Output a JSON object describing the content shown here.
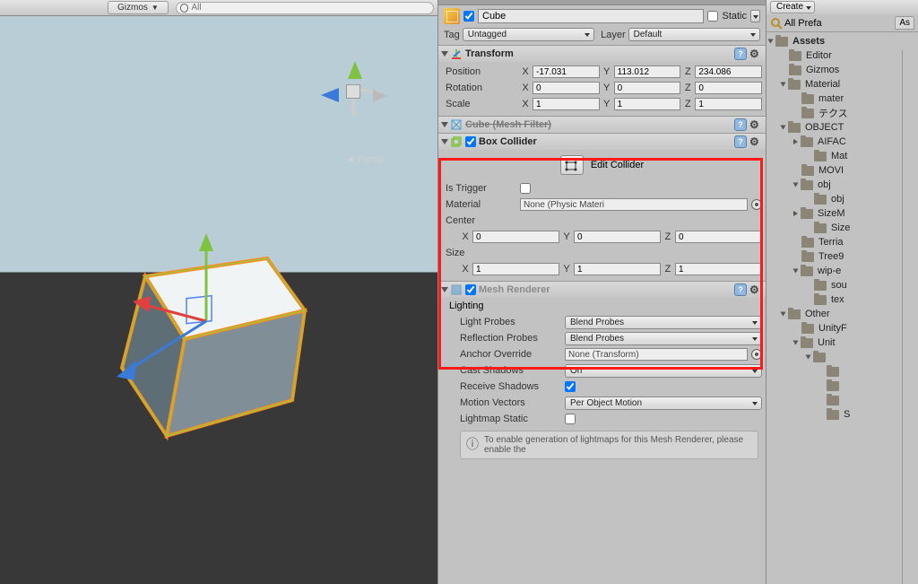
{
  "scene": {
    "gizmos_label": "Gizmos",
    "search_placeholder": "All",
    "persp_label": "Persp",
    "axis_y": "y"
  },
  "inspector": {
    "active": true,
    "name": "Cube",
    "static_label": "Static",
    "tag_label": "Tag",
    "tag_value": "Untagged",
    "layer_label": "Layer",
    "layer_value": "Default",
    "transform": {
      "title": "Transform",
      "position_label": "Position",
      "rotation_label": "Rotation",
      "scale_label": "Scale",
      "pos_x": "-17.031",
      "pos_y": "113.012",
      "pos_z": "234.086",
      "rot_x": "0",
      "rot_y": "0",
      "rot_z": "0",
      "scl_x": "1",
      "scl_y": "1",
      "scl_z": "1"
    },
    "mesh_filter": {
      "title": "Cube (Mesh Filter)"
    },
    "box_collider": {
      "title": "Box Collider",
      "edit_label": "Edit Collider",
      "is_trigger_label": "Is Trigger",
      "material_label": "Material",
      "material_value": "None (Physic Materi",
      "center_label": "Center",
      "center_x": "0",
      "center_y": "0",
      "center_z": "0",
      "size_label": "Size",
      "size_x": "1",
      "size_y": "1",
      "size_z": "1"
    },
    "mesh_renderer": {
      "title": "Mesh Renderer"
    },
    "lighting": {
      "title": "Lighting",
      "light_probes_label": "Light Probes",
      "light_probes_value": "Blend Probes",
      "reflection_probes_label": "Reflection Probes",
      "reflection_probes_value": "Blend Probes",
      "anchor_override_label": "Anchor Override",
      "anchor_override_value": "None (Transform)",
      "cast_shadows_label": "Cast Shadows",
      "cast_shadows_value": "On",
      "receive_shadows_label": "Receive Shadows",
      "motion_vectors_label": "Motion Vectors",
      "motion_vectors_value": "Per Object Motion",
      "lightmap_static_label": "Lightmap Static",
      "info_text": "To enable generation of lightmaps for this Mesh Renderer, please enable the"
    }
  },
  "project": {
    "create_label": "Create",
    "search_text": "All Prefa",
    "ass_tab": "As",
    "tree": [
      {
        "name": "Assets",
        "depth": 0,
        "open": true
      },
      {
        "name": "Editor",
        "depth": 1,
        "open": false,
        "leaf": true
      },
      {
        "name": "Gizmos",
        "depth": 1,
        "open": false,
        "leaf": true
      },
      {
        "name": "Material",
        "depth": 1,
        "open": true
      },
      {
        "name": "mater",
        "depth": 2,
        "open": false,
        "leaf": true
      },
      {
        "name": "テクス",
        "depth": 2,
        "open": false,
        "leaf": true
      },
      {
        "name": "OBJECT",
        "depth": 1,
        "open": true
      },
      {
        "name": "AIFAC",
        "depth": 2,
        "open": false
      },
      {
        "name": "Mat",
        "depth": 3,
        "open": false,
        "leaf": true
      },
      {
        "name": "MOVI",
        "depth": 2,
        "open": false,
        "leaf": true
      },
      {
        "name": "obj",
        "depth": 2,
        "open": true
      },
      {
        "name": "obj",
        "depth": 3,
        "open": false,
        "leaf": true
      },
      {
        "name": "SizeM",
        "depth": 2,
        "open": false
      },
      {
        "name": "Size",
        "depth": 3,
        "open": false,
        "leaf": true
      },
      {
        "name": "Terria",
        "depth": 2,
        "open": false,
        "leaf": true
      },
      {
        "name": "Tree9",
        "depth": 2,
        "open": false,
        "leaf": true
      },
      {
        "name": "wip-e",
        "depth": 2,
        "open": true
      },
      {
        "name": "sou",
        "depth": 3,
        "open": false,
        "leaf": true
      },
      {
        "name": "tex",
        "depth": 3,
        "open": false,
        "leaf": true
      },
      {
        "name": "Other",
        "depth": 1,
        "open": true
      },
      {
        "name": "UnityF",
        "depth": 2,
        "open": false,
        "leaf": true
      },
      {
        "name": "Unit",
        "depth": 2,
        "open": true
      },
      {
        "name": "",
        "depth": 3,
        "open": true
      },
      {
        "name": "",
        "depth": 4,
        "open": false,
        "leaf": true
      },
      {
        "name": "",
        "depth": 4,
        "open": false,
        "leaf": true
      },
      {
        "name": "",
        "depth": 4,
        "open": false,
        "leaf": true
      },
      {
        "name": "S",
        "depth": 4,
        "open": false,
        "leaf": true
      }
    ]
  }
}
